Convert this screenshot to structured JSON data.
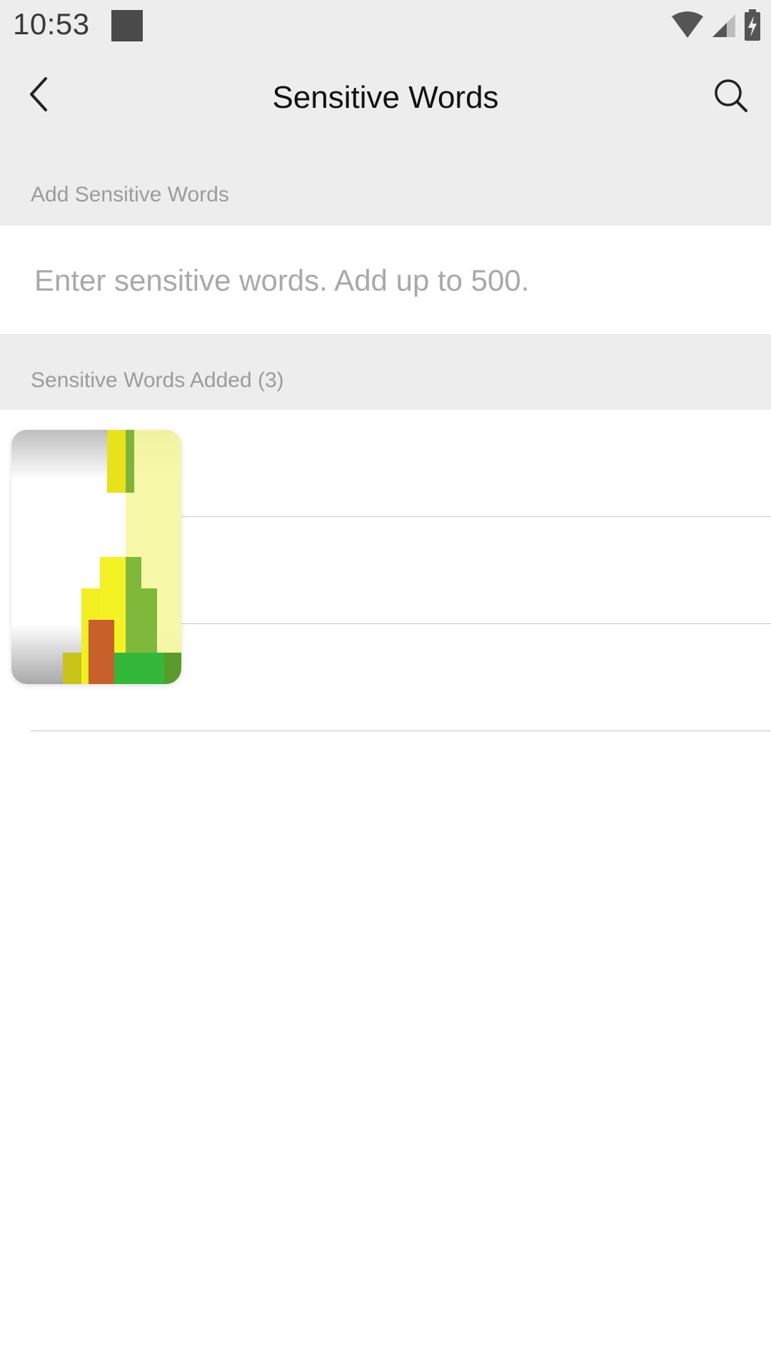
{
  "status_bar": {
    "time": "10:53"
  },
  "header": {
    "title": "Sensitive Words",
    "back_icon": "chevron-left-icon",
    "search_icon": "search-icon"
  },
  "add_section": {
    "label": "Add Sensitive Words",
    "input_placeholder": "Enter sensitive words. Add up to 500.",
    "input_value": ""
  },
  "added_section": {
    "label": "Sensitive Words Added (3)",
    "items": [
      {
        "label": ""
      },
      {
        "label": ""
      },
      {
        "label": ""
      }
    ]
  },
  "colors": {
    "header_bg": "#ededed",
    "section_text": "#9c9c9c",
    "placeholder": "#a9a9a9",
    "divider": "#c8c8c8"
  }
}
